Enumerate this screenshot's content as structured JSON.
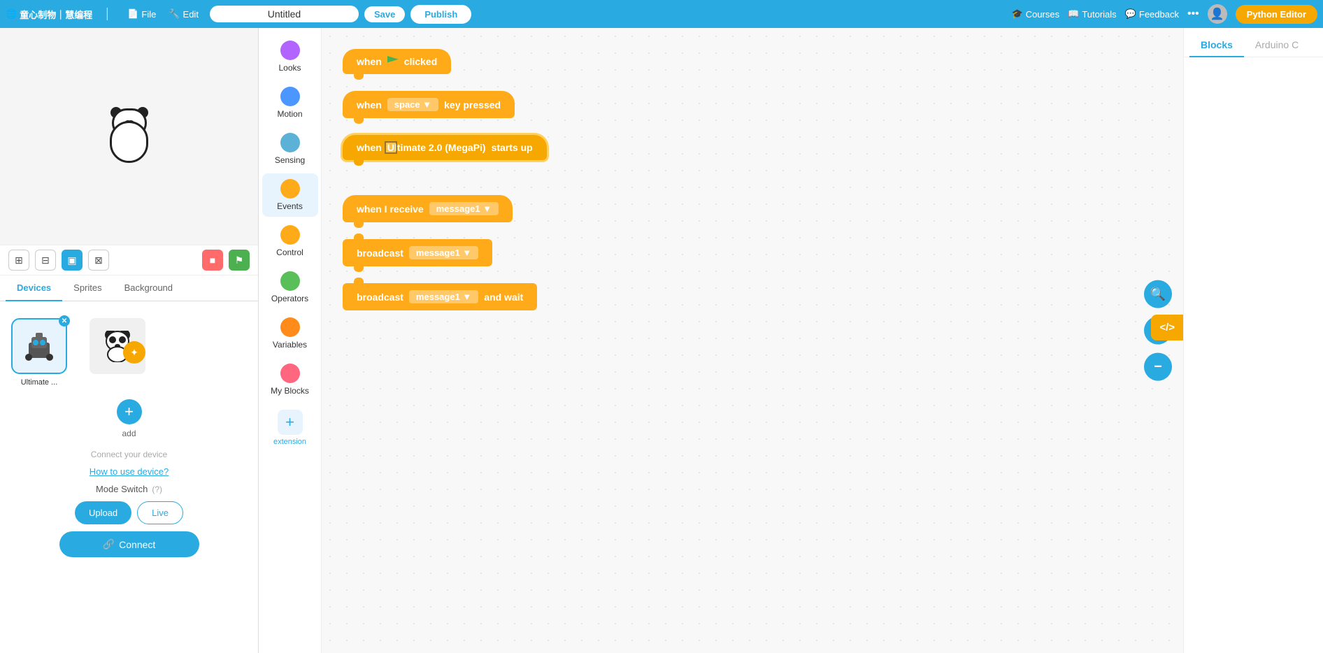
{
  "topnav": {
    "brand": "童心制物｜慧编程",
    "file_label": "File",
    "edit_label": "Edit",
    "title_placeholder": "Untitled",
    "save_label": "Save",
    "publish_label": "Publish",
    "courses_label": "Courses",
    "tutorials_label": "Tutorials",
    "feedback_label": "Feedback",
    "python_editor_label": "Python Editor"
  },
  "left_panel": {
    "tabs": [
      "Devices",
      "Sprites",
      "Background"
    ],
    "active_tab": "Devices",
    "device_name": "Ultimate ...",
    "connect_hint": "Connect your device",
    "how_to_label": "How to use device?",
    "mode_switch_label": "Mode Switch",
    "upload_label": "Upload",
    "live_label": "Live",
    "connect_label": "Connect",
    "add_label": "add"
  },
  "toolbar": {
    "icons": [
      "⊞",
      "⊟",
      "▣",
      "⊠"
    ],
    "stop_icon": "■",
    "flag_icon": "⚑"
  },
  "palette": {
    "items": [
      {
        "id": "looks",
        "label": "Looks",
        "color": "#b264ff"
      },
      {
        "id": "motion",
        "label": "Motion",
        "color": "#4c97ff"
      },
      {
        "id": "sensing",
        "label": "Sensing",
        "color": "#5cb1d6"
      },
      {
        "id": "events",
        "label": "Events",
        "color": "#ffab19"
      },
      {
        "id": "control",
        "label": "Control",
        "color": "#ffab19"
      },
      {
        "id": "operators",
        "label": "Operators",
        "color": "#59c059"
      },
      {
        "id": "variables",
        "label": "Variables",
        "color": "#ff8c1a"
      },
      {
        "id": "my_blocks",
        "label": "My Blocks",
        "color": "#ff6680"
      }
    ],
    "extension_label": "extension"
  },
  "blocks": [
    {
      "id": "when_flag_clicked",
      "type": "hat",
      "color": "#ffab19",
      "text": "when",
      "has_flag": true,
      "suffix": "clicked"
    },
    {
      "id": "when_key_pressed",
      "type": "hat",
      "color": "#ffab19",
      "text": "when",
      "dropdown": "space",
      "suffix": "key pressed"
    },
    {
      "id": "when_startup",
      "type": "hat",
      "color": "#f7a800",
      "text": "when",
      "value": "Ultimate 2.0 (MegaPi)",
      "suffix": "starts up",
      "active": true
    },
    {
      "id": "when_receive",
      "type": "hat",
      "color": "#ffab19",
      "text": "when I receive",
      "dropdown": "message1"
    },
    {
      "id": "broadcast",
      "type": "normal",
      "color": "#ffab19",
      "text": "broadcast",
      "dropdown": "message1"
    },
    {
      "id": "broadcast_wait",
      "type": "normal",
      "color": "#ffab19",
      "text": "broadcast",
      "dropdown": "message1",
      "suffix": "and wait"
    }
  ],
  "right_panel": {
    "tabs": [
      "Blocks",
      "Arduino C"
    ],
    "active_tab": "Blocks",
    "zoom_in_label": "+",
    "zoom_out_label": "−",
    "code_tag": "</>"
  }
}
